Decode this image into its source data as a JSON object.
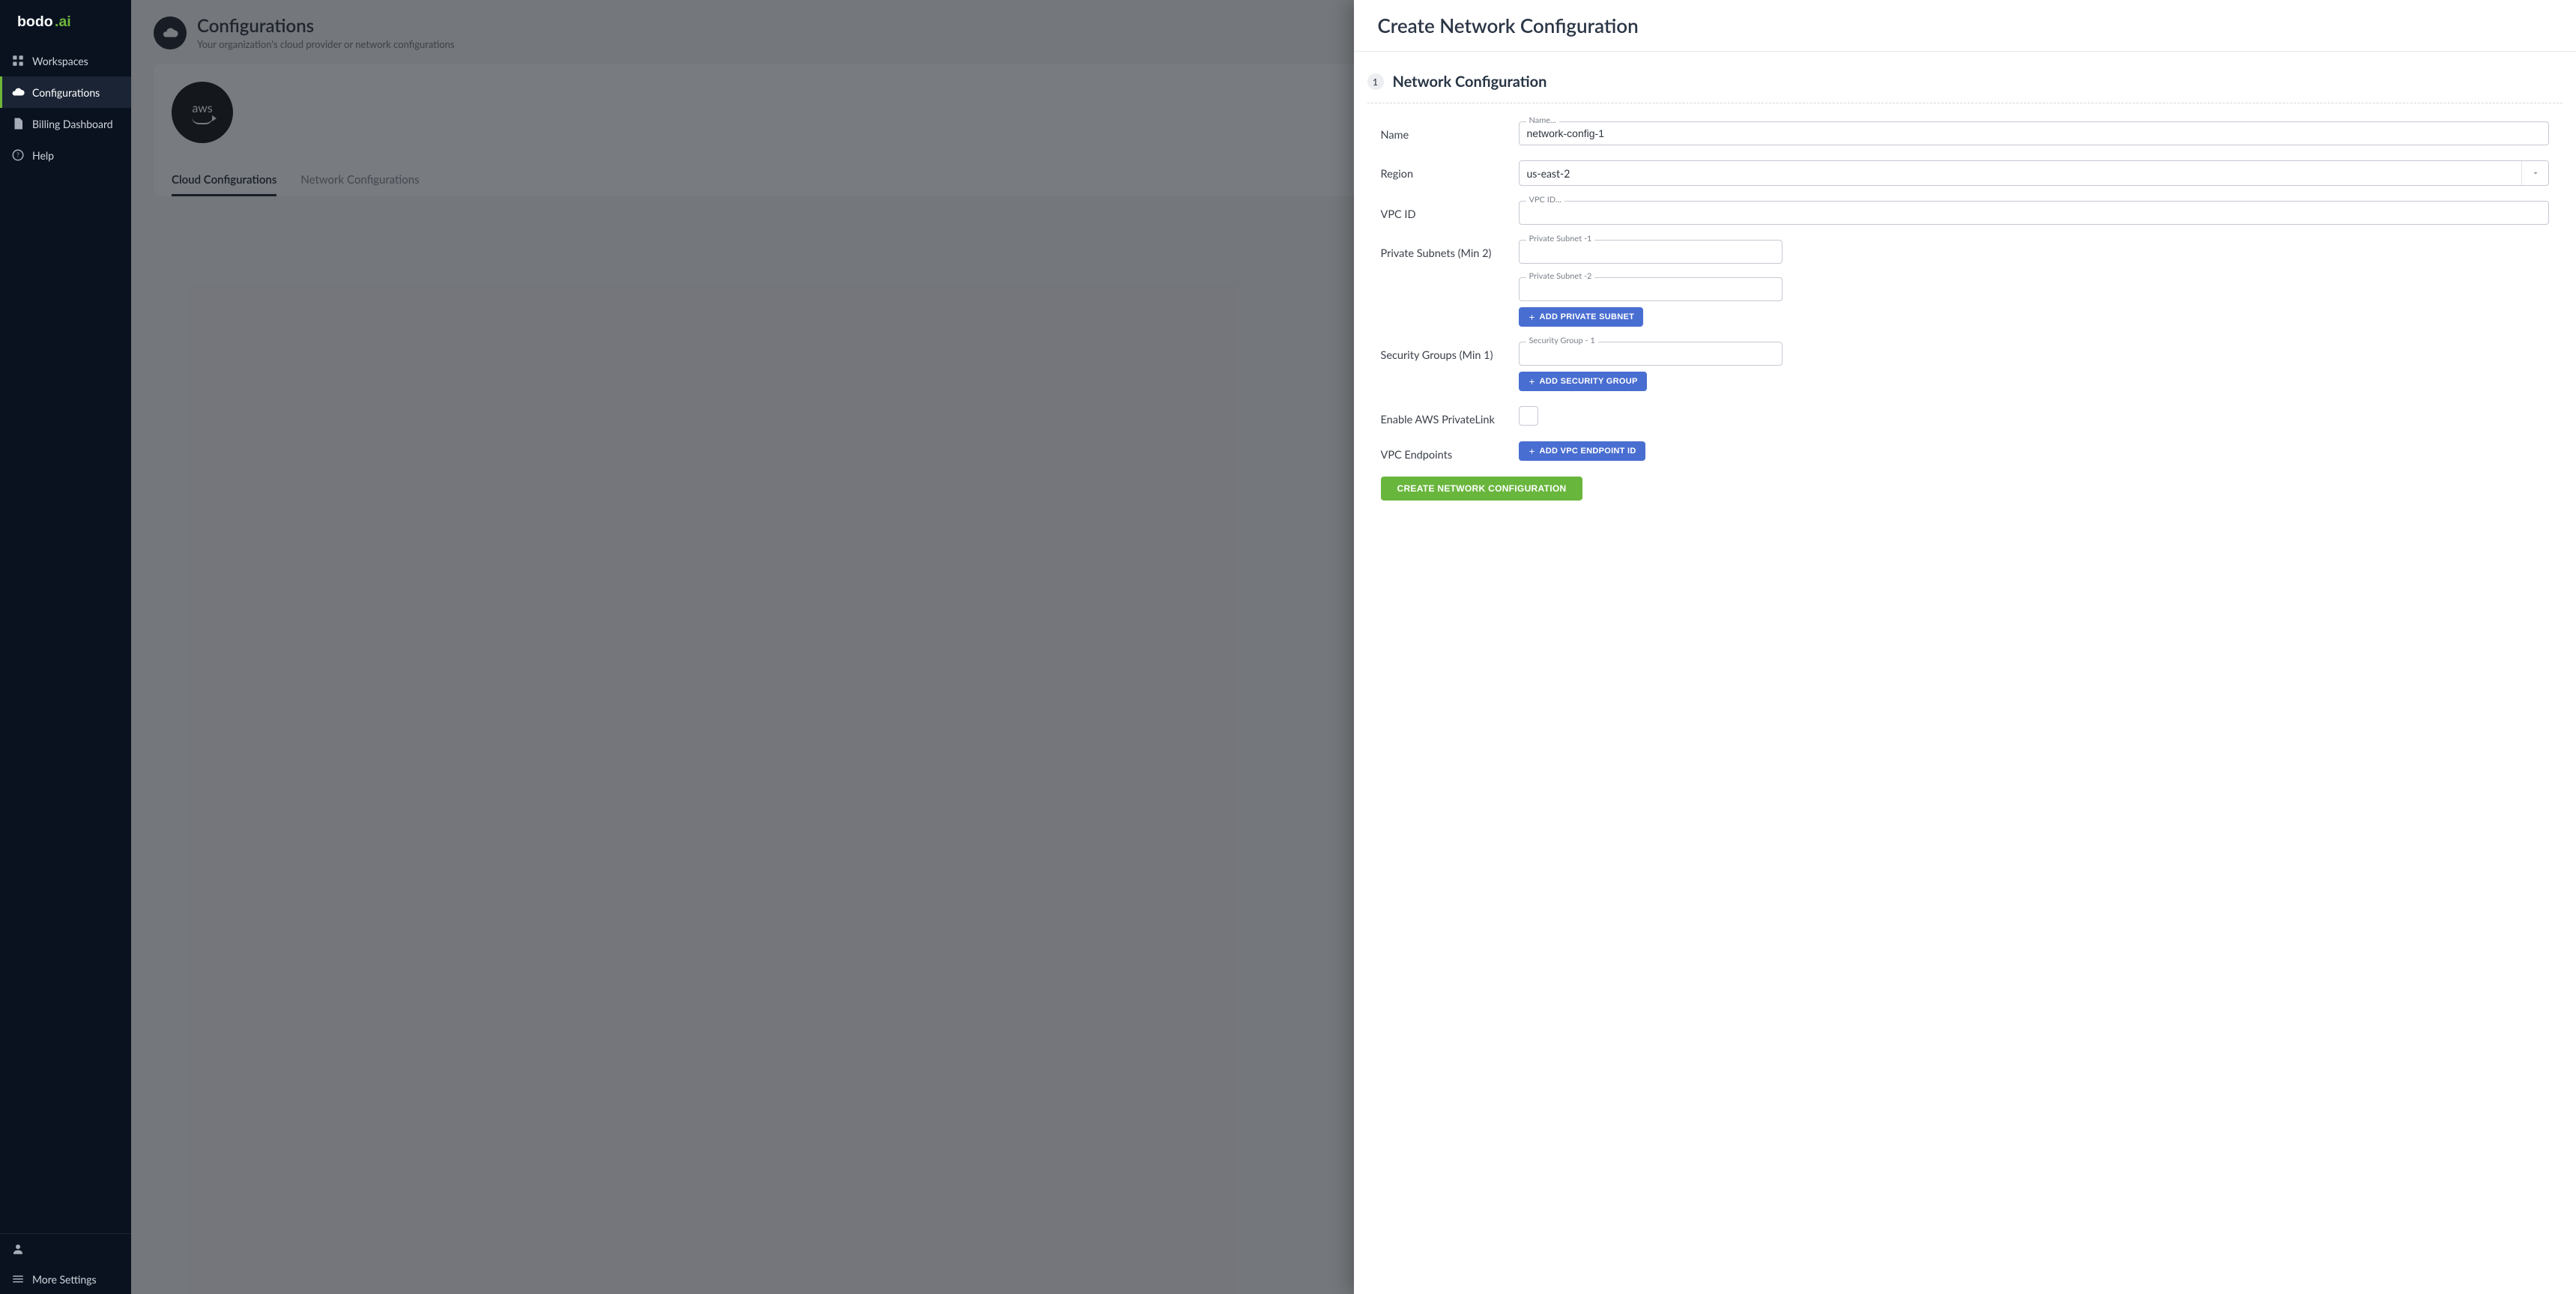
{
  "brand": {
    "name": "bodo",
    "suffix": ".ai"
  },
  "nav": {
    "items": [
      {
        "label": "Workspaces"
      },
      {
        "label": "Configurations"
      },
      {
        "label": "Billing Dashboard"
      },
      {
        "label": "Help"
      }
    ],
    "bottom": [
      {
        "label": ""
      },
      {
        "label": "More Settings"
      }
    ]
  },
  "page": {
    "title": "Configurations",
    "subtitle": "Your organization's cloud provider or network configurations",
    "aws_label": "aws",
    "tabs": [
      {
        "label": "Cloud Configurations"
      },
      {
        "label": "Network Configurations"
      }
    ]
  },
  "panel": {
    "title": "Create Network Configuration",
    "step": {
      "num": "1",
      "title": "Network Configuration"
    },
    "form": {
      "name": {
        "label": "Name",
        "legend": "Name...",
        "value": "network-config-1"
      },
      "region": {
        "label": "Region",
        "value": "us-east-2"
      },
      "vpc": {
        "label": "VPC ID",
        "legend": "VPC ID...",
        "value": ""
      },
      "subnets": {
        "label": "Private Subnets (Min 2)",
        "fields": [
          {
            "legend": "Private Subnet -1",
            "value": ""
          },
          {
            "legend": "Private Subnet -2",
            "value": ""
          }
        ],
        "add_btn": "Add Private Subnet"
      },
      "sg": {
        "label": "Security Groups (Min 1)",
        "fields": [
          {
            "legend": "Security Group - 1",
            "value": ""
          }
        ],
        "add_btn": "Add Security Group"
      },
      "privatelink": {
        "label": "Enable AWS PrivateLink"
      },
      "endpoints": {
        "label": "VPC Endpoints",
        "add_btn": "Add VPC Endpoint ID"
      },
      "submit": "Create Network Configuration"
    }
  }
}
